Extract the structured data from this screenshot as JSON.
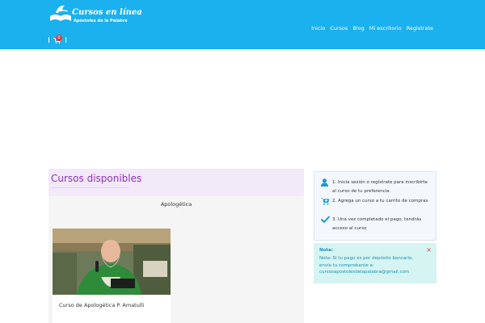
{
  "header": {
    "logo_title": "Cursos en línea",
    "logo_subtitle": "Apóstoles de la Palabra",
    "nav": [
      "Inicio",
      "Cursos",
      "Blog",
      "Mi escritorio",
      "Registrate"
    ],
    "cart_count": "0",
    "colors": {
      "bar": "#1ab1ee",
      "badge": "#e53935"
    }
  },
  "courses": {
    "title": "Cursos disponibles",
    "category": "Apologética",
    "items": [
      {
        "name": "Curso de Apologética P. Amatulli",
        "image": "priest-photo"
      }
    ]
  },
  "sidebar": {
    "steps": [
      {
        "icon": "user-icon",
        "text": "1. Inicia sesión o regístrate para inscribirte al curso de tu preferencia."
      },
      {
        "icon": "cart-plus-icon",
        "text": "2. Agrega un curso a tu carrito de compras"
      },
      {
        "icon": "checkmark-icon",
        "text": "3. Una vez completado el pago, tendrás acceso al curso"
      }
    ],
    "note": {
      "title": "Nota:",
      "text": "Nota: Si tu pago es por depósito bancario, envía tu comprobante a: cursosapostolesdelapalabra@gmail.com",
      "close_icon": "close-icon"
    }
  }
}
